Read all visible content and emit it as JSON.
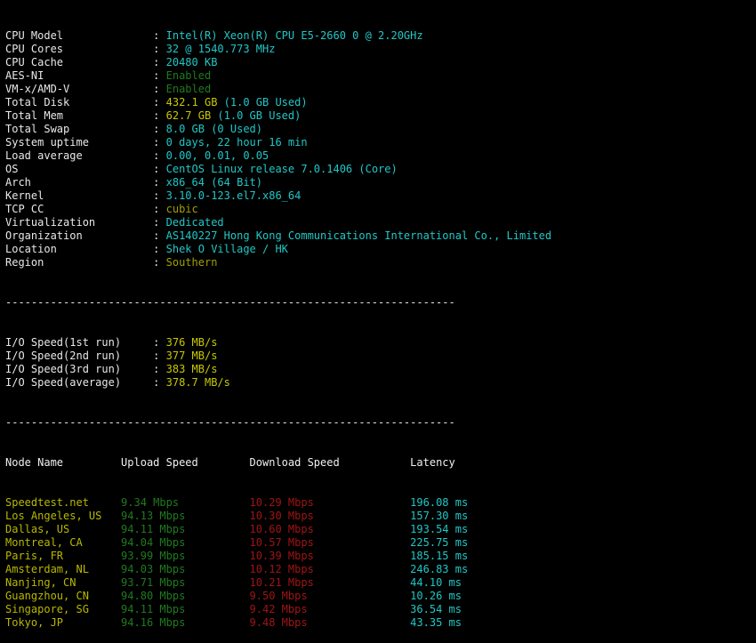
{
  "terminal": {
    "colors": {
      "background": "#000000",
      "label": "#e8e8e8",
      "cyan": "#21c7c7",
      "yellow": "#c8c800",
      "olive": "#a0a000",
      "dim_green": "#1f7a1f",
      "dark_red": "#a01414",
      "node_name": "#b8b800"
    },
    "separator": "----------------------------------------------------------------------"
  },
  "system_info": {
    "rows": [
      {
        "label": "CPU Model",
        "value": "Intel(R) Xeon(R) CPU E5-2660 0 @ 2.20GHz",
        "color": "cyan"
      },
      {
        "label": "CPU Cores",
        "value": "32 @ 1540.773 MHz",
        "color": "cyan"
      },
      {
        "label": "CPU Cache",
        "value": "20480 KB",
        "color": "cyan"
      },
      {
        "label": "AES-NI",
        "value": "Enabled",
        "color": "dimgreen"
      },
      {
        "label": "VM-x/AMD-V",
        "value": "Enabled",
        "color": "dimgreen"
      },
      {
        "label": "Total Disk",
        "value": "432.1 GB",
        "value2": " (1.0 GB Used)",
        "color": "yellow",
        "color2": "cyan"
      },
      {
        "label": "Total Mem",
        "value": "62.7 GB",
        "value2": " (1.0 GB Used)",
        "color": "yellow",
        "color2": "cyan"
      },
      {
        "label": "Total Swap",
        "value": "8.0 GB (0 Used)",
        "color": "cyan"
      },
      {
        "label": "System uptime",
        "value": "0 days, 22 hour 16 min",
        "color": "cyan"
      },
      {
        "label": "Load average",
        "value": "0.00, 0.01, 0.05",
        "color": "cyan"
      },
      {
        "label": "OS",
        "value": "CentOS Linux release 7.0.1406 (Core)",
        "color": "cyan"
      },
      {
        "label": "Arch",
        "value": "x86_64 (64 Bit)",
        "color": "cyan"
      },
      {
        "label": "Kernel",
        "value": "3.10.0-123.el7.x86_64",
        "color": "cyan"
      },
      {
        "label": "TCP CC",
        "value": "cubic",
        "color": "olive"
      },
      {
        "label": "Virtualization",
        "value": "Dedicated",
        "color": "cyan"
      },
      {
        "label": "Organization",
        "value": "AS140227 Hong Kong Communications International Co., Limited",
        "color": "cyan"
      },
      {
        "label": "Location",
        "value": "Shek O Village / HK",
        "color": "cyan"
      },
      {
        "label": "Region",
        "value": "Southern",
        "color": "olive"
      }
    ]
  },
  "io_speed": {
    "rows": [
      {
        "label": "I/O Speed(1st run)",
        "value": "376 MB/s"
      },
      {
        "label": "I/O Speed(2nd run)",
        "value": "377 MB/s"
      },
      {
        "label": "I/O Speed(3rd run)",
        "value": "383 MB/s"
      },
      {
        "label": "I/O Speed(average)",
        "value": "378.7 MB/s"
      }
    ]
  },
  "network_test": {
    "headers": {
      "node_name": "Node Name",
      "upload": "Upload Speed",
      "download": "Download Speed",
      "latency": "Latency"
    },
    "rows": [
      {
        "node": "Speedtest.net",
        "upload": "9.34 Mbps",
        "download": "10.29 Mbps",
        "latency": "196.08 ms"
      },
      {
        "node": "Los Angeles, US",
        "upload": "94.13 Mbps",
        "download": "10.30 Mbps",
        "latency": "157.30 ms"
      },
      {
        "node": "Dallas, US",
        "upload": "94.11 Mbps",
        "download": "10.60 Mbps",
        "latency": "193.54 ms"
      },
      {
        "node": "Montreal, CA",
        "upload": "94.04 Mbps",
        "download": "10.57 Mbps",
        "latency": "225.75 ms"
      },
      {
        "node": "Paris, FR",
        "upload": "93.99 Mbps",
        "download": "10.39 Mbps",
        "latency": "185.15 ms"
      },
      {
        "node": "Amsterdam, NL",
        "upload": "94.03 Mbps",
        "download": "10.12 Mbps",
        "latency": "246.83 ms"
      },
      {
        "node": "Nanjing, CN",
        "upload": "93.71 Mbps",
        "download": "10.21 Mbps",
        "latency": "44.10 ms"
      },
      {
        "node": "Guangzhou, CN",
        "upload": "94.80 Mbps",
        "download": "9.50 Mbps",
        "latency": "10.26 ms"
      },
      {
        "node": "Singapore, SG",
        "upload": "94.11 Mbps",
        "download": "9.42 Mbps",
        "latency": "36.54 ms"
      },
      {
        "node": "Tokyo, JP",
        "upload": "94.16 Mbps",
        "download": "9.48 Mbps",
        "latency": "43.35 ms"
      }
    ]
  }
}
